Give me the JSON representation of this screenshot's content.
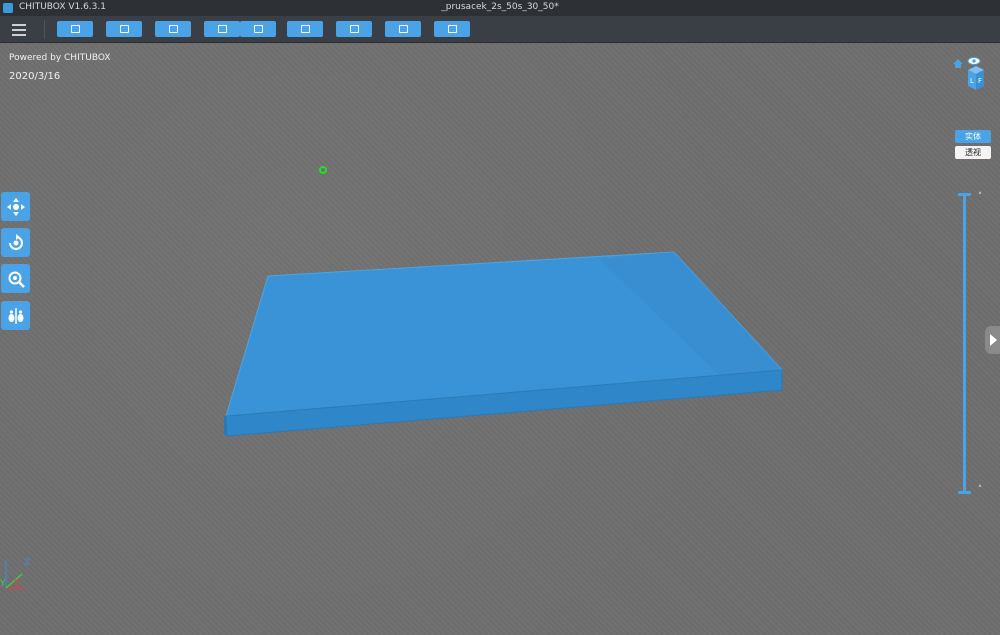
{
  "app": {
    "name": "CHITUBOX V1.6.3.1",
    "document_title": "_prusacek_2s_50s_30_50*"
  },
  "toolbar": {
    "menu_icon": "hamburger-menu-icon",
    "buttons": [
      {
        "icon": "open-file-icon"
      },
      {
        "icon": "save-icon"
      },
      {
        "icon": "layout-icon"
      },
      {
        "icon": "import-icon"
      },
      {
        "icon": "export-icon"
      },
      {
        "icon": "slice-icon"
      },
      {
        "icon": "hierarchy-icon"
      },
      {
        "icon": "support-icon"
      },
      {
        "icon": "settings-icon"
      }
    ]
  },
  "viewport": {
    "powered_by": "Powered by CHITUBOX",
    "date": "2020/3/16",
    "render_modes": {
      "solid": "实体",
      "transparent": "透视"
    },
    "left_tools": [
      {
        "icon": "move-icon"
      },
      {
        "icon": "rotate-icon"
      },
      {
        "icon": "scale-icon"
      },
      {
        "icon": "mirror-icon"
      }
    ],
    "slider": {
      "up_arrow": "˅",
      "down_arrow": "˄"
    },
    "axis_labels": {
      "x": "X",
      "y": "Y",
      "z": "Z"
    }
  },
  "colors": {
    "accent": "#4aa3e6",
    "model_top": "#3a93d6",
    "model_side": "#2f86c8",
    "background": "#6e6e6e",
    "cursor": "#25e02a"
  }
}
